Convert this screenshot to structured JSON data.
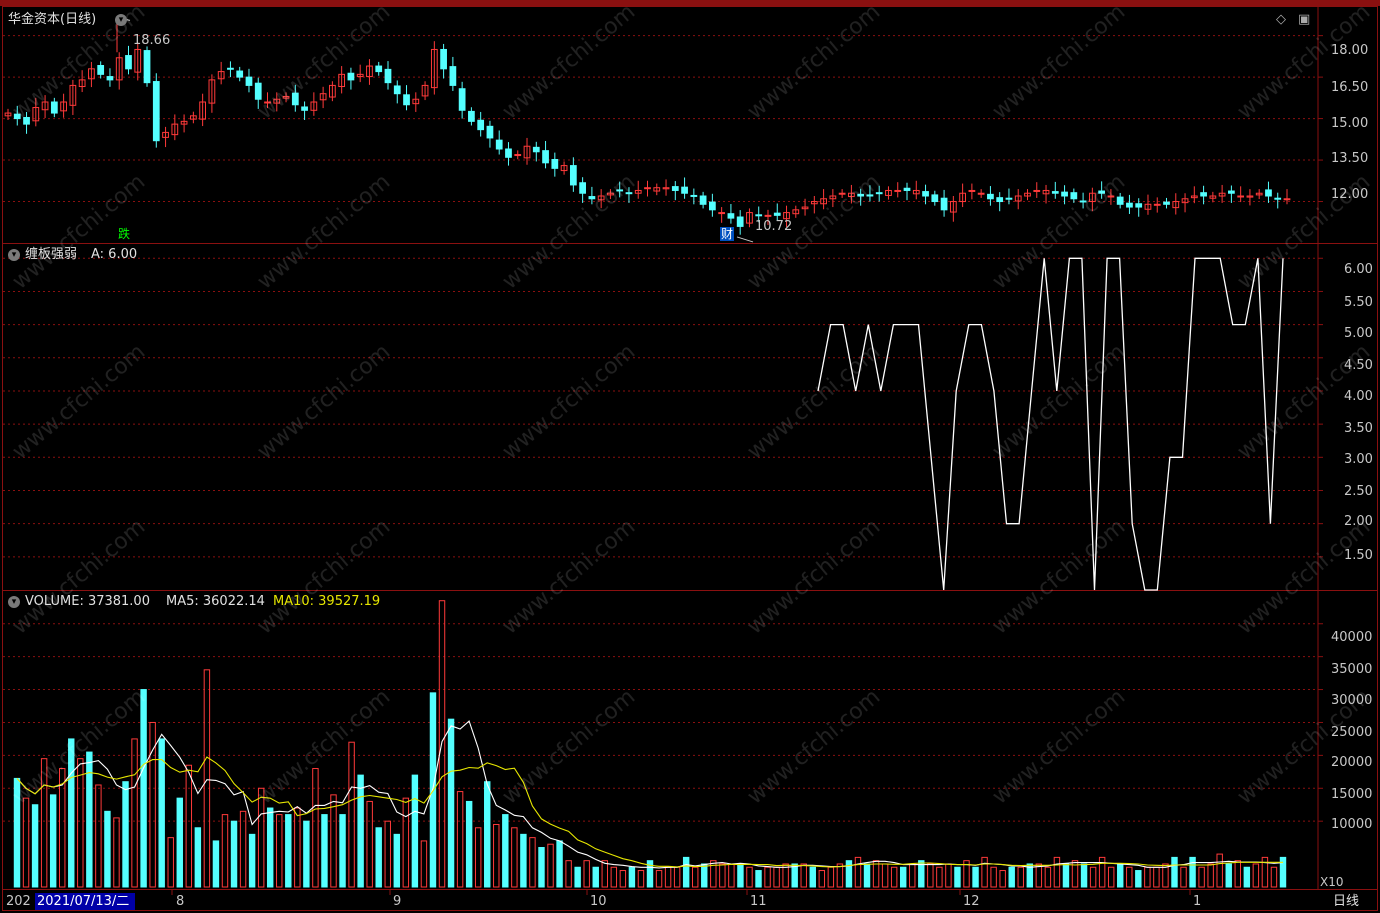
{
  "stock": {
    "title": "华金资本(日线)"
  },
  "price_panel": {
    "high_marker": "18.66",
    "low_marker": "10.72",
    "die_tag": "跌",
    "cai_tag": "财",
    "y_ticks": [
      "18.00",
      "16.50",
      "15.00",
      "13.50",
      "12.00"
    ]
  },
  "indicator_panel": {
    "title": "缠板强弱",
    "a_label": "A: 6.00",
    "y_ticks": [
      "6.00",
      "5.50",
      "5.00",
      "4.50",
      "4.00",
      "3.50",
      "3.00",
      "2.50",
      "2.00",
      "1.50"
    ]
  },
  "volume_panel": {
    "volume_label": "VOLUME: 37381.00",
    "ma5_label": "MA5: 36022.14",
    "ma10_label": "MA10: 39527.19",
    "y_ticks": [
      "40000",
      "35000",
      "30000",
      "25000",
      "20000",
      "15000",
      "10000"
    ],
    "x10_label": "X10"
  },
  "x_axis": {
    "year_label": "202",
    "cursor_date": "2021/07/13/二",
    "months": [
      "8",
      "9",
      "10",
      "11",
      "12",
      "1"
    ],
    "period_label": "日线"
  },
  "watermark": "www.cfchi.com",
  "colors": {
    "up": "#ff3a3a",
    "down": "#54ffff",
    "grid": "#8a1010",
    "white_line": "#ffffff",
    "yellow_line": "#e6e600",
    "label_yellow": "#e6e600"
  },
  "chart_data": [
    {
      "type": "candlestick",
      "title": "华金资本(日线)",
      "x_months": [
        "7",
        "8",
        "9",
        "10",
        "11",
        "12",
        "1"
      ],
      "ylim": [
        10.5,
        19.0
      ],
      "closes": [
        15.2,
        15.0,
        14.8,
        15.4,
        15.6,
        15.2,
        15.6,
        16.2,
        16.4,
        16.8,
        16.6,
        16.4,
        17.2,
        16.8,
        17.5,
        16.3,
        14.2,
        14.5,
        14.8,
        14.9,
        15.1,
        15.6,
        16.4,
        16.7,
        16.8,
        16.5,
        16.2,
        15.7,
        15.6,
        15.7,
        15.8,
        15.5,
        15.3,
        15.6,
        15.9,
        16.2,
        16.6,
        16.4,
        16.6,
        16.9,
        16.7,
        16.3,
        15.9,
        15.5,
        15.7,
        16.2,
        17.5,
        16.8,
        16.2,
        15.3,
        14.9,
        14.6,
        14.3,
        13.9,
        13.6,
        13.7,
        14.0,
        13.8,
        13.4,
        13.2,
        13.3,
        12.6,
        12.3,
        12.1,
        12.2,
        12.3,
        12.4,
        12.3,
        12.4,
        12.5,
        12.5,
        12.5,
        12.4,
        12.3,
        12.2,
        11.9,
        11.7,
        11.6,
        11.4,
        11.1,
        11.6,
        11.5,
        11.5,
        11.5,
        11.6,
        11.7,
        11.8,
        12.0,
        12.1,
        12.2,
        12.3,
        12.3,
        12.2,
        12.2,
        12.3,
        12.4,
        12.4,
        12.4,
        12.4,
        12.2,
        12.0,
        11.7,
        12.0,
        12.3,
        12.4,
        12.3,
        12.1,
        12.0,
        12.1,
        12.2,
        12.3,
        12.4,
        12.4,
        12.3,
        12.2,
        12.1,
        12.0,
        12.3,
        12.3,
        12.2,
        11.9,
        11.8,
        11.8,
        11.9,
        11.9,
        11.9,
        12.0,
        12.1,
        12.2,
        12.2,
        12.2,
        12.3,
        12.3,
        12.2,
        12.2,
        12.3,
        12.2,
        12.1,
        12.1
      ],
      "high_marker": 18.66,
      "low_marker": 10.72
    },
    {
      "type": "line",
      "title": "缠板强弱",
      "series": [
        {
          "name": "A",
          "values": [
            4,
            5,
            5,
            4,
            5,
            4,
            5,
            5,
            5,
            3,
            1,
            4,
            5,
            5,
            4,
            2,
            2,
            4,
            6,
            4,
            6,
            6,
            1,
            6,
            6,
            2,
            1,
            1,
            3,
            3,
            6,
            6,
            6,
            5,
            5,
            6,
            2,
            6
          ]
        }
      ],
      "ylim": [
        1.0,
        6.2
      ]
    },
    {
      "type": "bar",
      "title": "VOLUME",
      "ylim": [
        0,
        43000
      ],
      "values": [
        16500,
        13500,
        12500,
        19500,
        14000,
        18000,
        22500,
        19500,
        20500,
        15500,
        11500,
        10500,
        16000,
        22500,
        30000,
        25000,
        22500,
        7500,
        13500,
        18500,
        9000,
        33000,
        7000,
        11000,
        10000,
        11500,
        8000,
        15000,
        12000,
        11000,
        11000,
        12000,
        10000,
        18000,
        11000,
        14000,
        11000,
        22000,
        17000,
        13000,
        9000,
        10000,
        8000,
        13500,
        17000,
        7000,
        29500,
        43500,
        25500,
        14500,
        13000,
        9000,
        16000,
        9500,
        11000,
        9000,
        8000,
        7500,
        6000,
        6500,
        7000,
        4000,
        3000,
        4000,
        3000,
        4000,
        3000,
        2500,
        3000,
        2500,
        4000,
        2500,
        3000,
        3000,
        4500,
        3000,
        3500,
        4000,
        3500,
        3500,
        3500,
        3000,
        2500,
        3000,
        3000,
        3500,
        3500,
        3500,
        3000,
        2500,
        3000,
        3500,
        4000,
        4500,
        3500,
        4000,
        3500,
        3000,
        3000,
        3500,
        4000,
        3500,
        3000,
        3500,
        3000,
        4000,
        3000,
        4500,
        3000,
        2500,
        3000,
        3000,
        3500,
        3500,
        3000,
        4500,
        3500,
        4000,
        3500,
        3000,
        4500,
        3000,
        3500,
        3000,
        2500,
        3000,
        3000,
        3500,
        4500,
        3000,
        4500,
        3000,
        3500,
        5000,
        3500,
        4000,
        3000,
        3500,
        4500,
        3000,
        4500
      ],
      "ma5_last": 36022.14,
      "ma10_last": 39527.19,
      "last_volume": 37381.0
    }
  ]
}
